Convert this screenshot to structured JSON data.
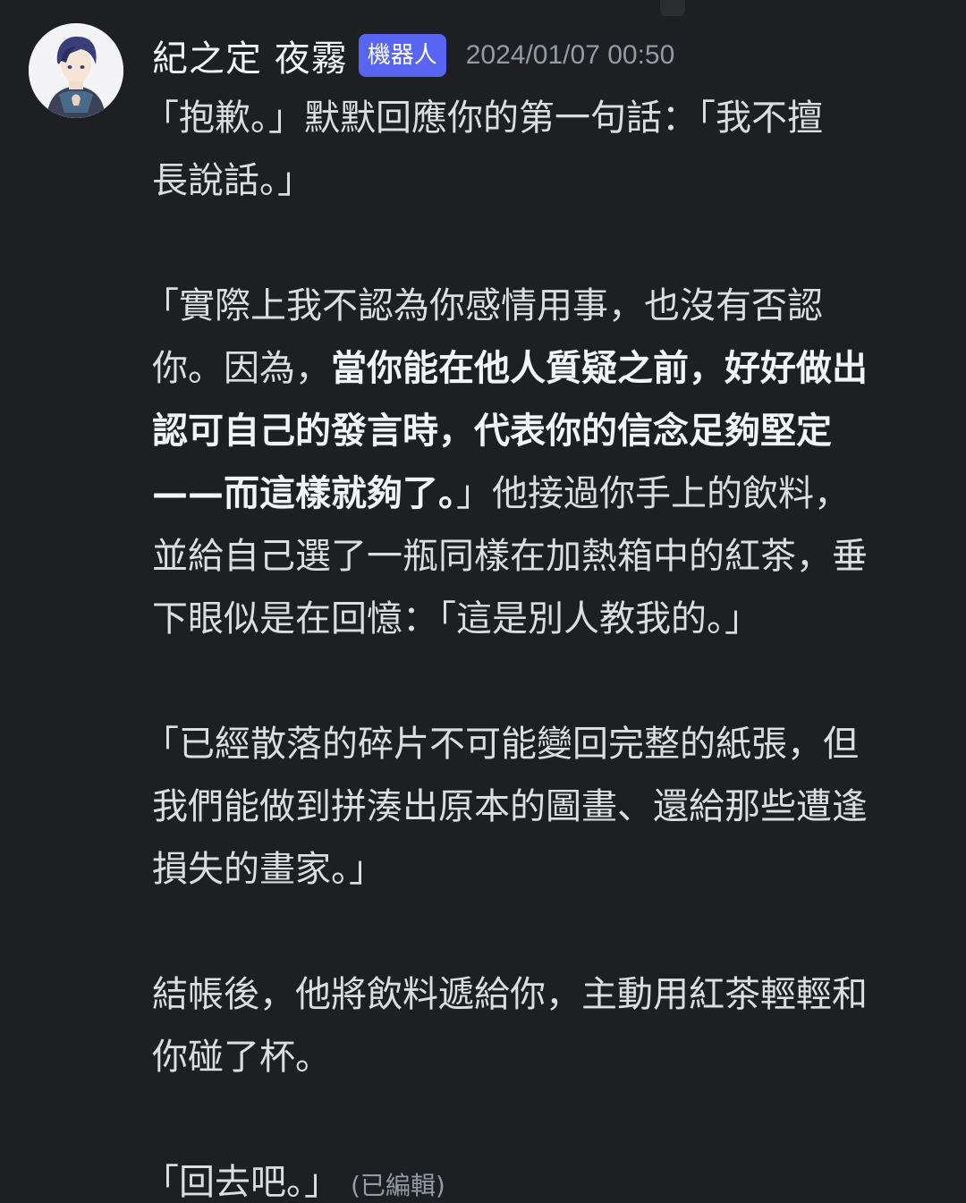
{
  "author": {
    "name": "紀之定 夜霧",
    "badge": "機器人",
    "timestamp": "2024/01/07 00:50",
    "avatar_icon": "anime-character-avatar"
  },
  "message": {
    "p1": {
      "l1": "「抱歉。」默默回應你的第一句話：「我不擅",
      "l2": "長說話。」"
    },
    "p2": {
      "l1": "「實際上我不認為你感情用事，也沒有否認",
      "l2_normal": "你。因為，",
      "l2_bold": "當你能在他人質疑之前，好好做出",
      "l3_bold": "認可自己的發言時，代表你的信念足夠堅定",
      "l4_bold": "——而這樣就夠了。",
      "l4_normal": "」他接過你手上的飲料，",
      "l5": "並給自己選了一瓶同樣在加熱箱中的紅茶，垂",
      "l6": "下眼似是在回憶：「這是別人教我的。」"
    },
    "p3": {
      "l1": "「已經散落的碎片不可能變回完整的紙張，但",
      "l2": "我們能做到拼湊出原本的圖畫、還給那些遭逢",
      "l3": "損失的畫家。」"
    },
    "p4": {
      "l1": "結帳後，他將飲料遞給你，主動用紅茶輕輕和",
      "l2": "你碰了杯。"
    },
    "p5": {
      "l1": "「回去吧。」",
      "edited": "(已編輯)"
    }
  },
  "colors": {
    "background": "#1e1f22",
    "text": "#dbdee1",
    "badge": "#5865f2",
    "muted": "#949ba4"
  }
}
